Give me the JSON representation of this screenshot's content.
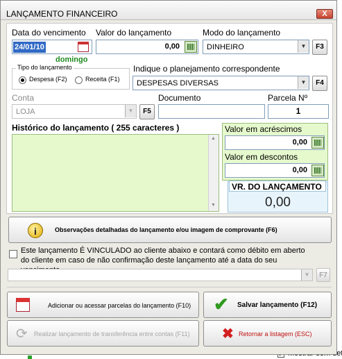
{
  "window": {
    "title": "LANÇAMENTO FINANCEIRO",
    "close_label": "X"
  },
  "due_date": {
    "label": "Data do vencimento",
    "value": "24/01/10",
    "weekday": "domingo"
  },
  "amount": {
    "label": "Valor do lançamento",
    "value": "0,00"
  },
  "mode": {
    "label": "Modo do lançamento",
    "value": "DINHEIRO",
    "shortcut": "F3"
  },
  "type_group": {
    "label": "Tipo do lançamento",
    "expense_label": "Despesa (F2)",
    "income_label": "Receita (F1)",
    "selected": "Despesa (F2)"
  },
  "planning": {
    "label": "Indique o planejamento correspondente",
    "value": "DESPESAS DIVERSAS",
    "shortcut": "F4"
  },
  "account": {
    "label": "Conta",
    "value": "LOJA",
    "shortcut": "F5"
  },
  "document": {
    "label": "Documento",
    "value": ""
  },
  "installment": {
    "label": "Parcela Nº",
    "value": "1"
  },
  "history": {
    "label": "Histórico do lançamento ( 255 caracteres )",
    "value": ""
  },
  "additions": {
    "label": "Valor em acréscimos",
    "value": "0,00"
  },
  "discounts": {
    "label": "Valor em descontos",
    "value": "0,00"
  },
  "total": {
    "label": "VR. DO LANÇAMENTO",
    "value": "0,00"
  },
  "observations_button": {
    "label": "Observações detalhadas do lançamento e/ou imagem de comprovante (F6)"
  },
  "linked_client": {
    "text": "Este lançamento É VINCULADO ao cliente abaixo e contará como débito em aberto do cliente em caso de não confirmação deste lançamento até a data do seu vencimento",
    "checked": false,
    "client_value": "",
    "shortcut": "F7"
  },
  "buttons": {
    "installments": "Adicionar ou acessar parcelas do lançamento (F10)",
    "save": "Salvar lançamento (F12)",
    "transfer": "Realizar lançamento de transferência entre contas (F11)",
    "back": "Retornar a listagem (ESC)"
  },
  "background": {
    "checkbox_label": "Mostrar sem det"
  },
  "colors": {
    "accent_green": "#e6f9cd",
    "weekday_green": "#1e8a1e",
    "total_blue": "#e8f4fb"
  }
}
